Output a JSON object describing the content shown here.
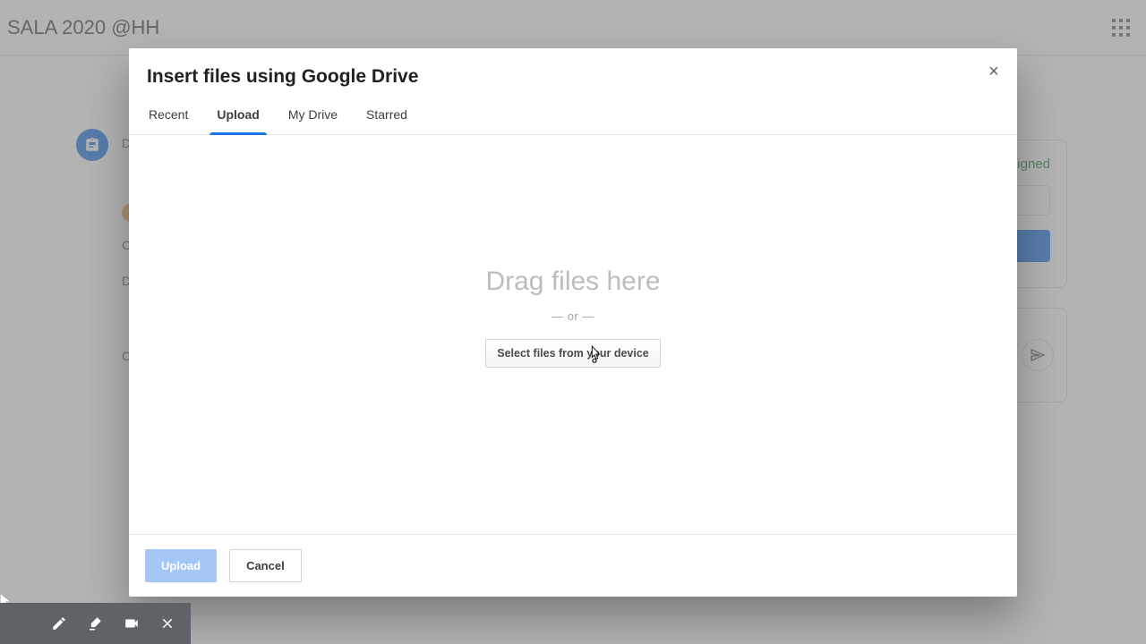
{
  "background": {
    "page_title": "SALA 2020 @HH",
    "lines": [
      "D",
      "C",
      "D",
      "C"
    ],
    "right_card": {
      "assigned_label": "igned"
    }
  },
  "modal": {
    "title": "Insert files using Google Drive",
    "tabs": {
      "recent": "Recent",
      "upload": "Upload",
      "my_drive": "My Drive",
      "starred": "Starred"
    },
    "active_tab": "upload",
    "body": {
      "drag_text": "Drag files here",
      "or_text": "— or —",
      "select_button": "Select files from your device"
    },
    "footer": {
      "upload_label": "Upload",
      "cancel_label": "Cancel"
    }
  }
}
